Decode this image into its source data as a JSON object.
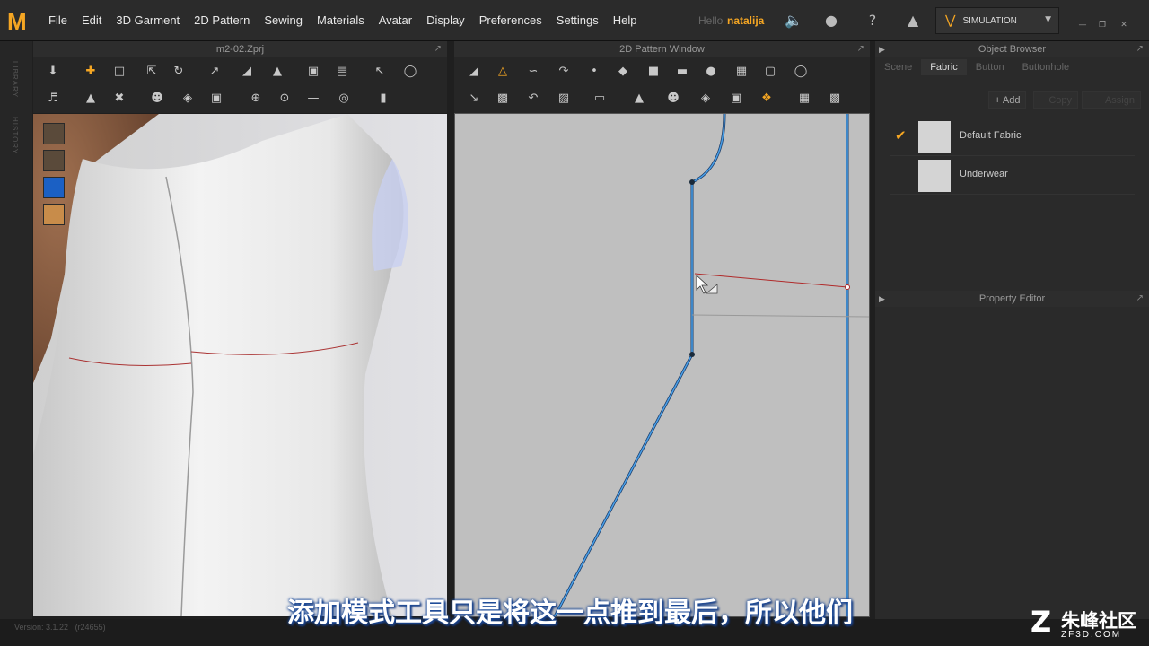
{
  "app": {
    "logo": "M"
  },
  "menu": [
    "File",
    "Edit",
    "3D Garment",
    "2D Pattern",
    "Sewing",
    "Materials",
    "Avatar",
    "Display",
    "Preferences",
    "Settings",
    "Help"
  ],
  "user": {
    "greeting": "Hello",
    "name": "natalija"
  },
  "simulation": {
    "label": "SIMULATION"
  },
  "sidebar": {
    "tabs": [
      "LIBRARY",
      "HISTORY"
    ]
  },
  "view3d": {
    "title": "m2-02.Zprj"
  },
  "view2d": {
    "title": "2D Pattern Window"
  },
  "object_browser": {
    "title": "Object Browser",
    "tabs": [
      "Scene",
      "Fabric",
      "Button",
      "Buttonhole"
    ],
    "active_tab": "Fabric",
    "buttons": {
      "add": "Add",
      "copy": "Copy",
      "assign": "Assign"
    },
    "fabrics": [
      {
        "name": "Default Fabric",
        "selected": true
      },
      {
        "name": "Underwear",
        "selected": false
      }
    ]
  },
  "property_editor": {
    "title": "Property Editor"
  },
  "status": {
    "version": "Version: 3.1.22",
    "build": "(r24655)"
  },
  "subtitle": "添加模式工具只是将这一点推到最后，所以他们",
  "watermark": {
    "cn": "朱峰社区",
    "en": "ZF3D.COM",
    "logo_letter": "Z"
  },
  "colors": {
    "accent": "#f5a623",
    "pattern_line": "#2b78c4",
    "seam_line": "#b02a2a"
  }
}
